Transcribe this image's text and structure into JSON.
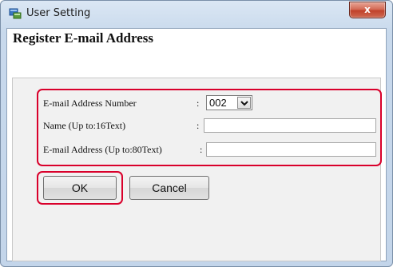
{
  "window": {
    "title": "User Setting",
    "close_label": "x"
  },
  "form": {
    "heading": "Register E-mail Address",
    "fields": [
      {
        "label": "E-mail Address Number",
        "colon": ":",
        "value": "002"
      },
      {
        "label": "Name (Up to:16Text)",
        "colon": ":",
        "value": ""
      },
      {
        "label": "E-mail Address (Up to:80Text)",
        "colon": ":",
        "value": ""
      }
    ]
  },
  "buttons": {
    "ok_label": "OK",
    "cancel_label": "Cancel"
  },
  "colors": {
    "highlight": "#d9002b",
    "title_bar": "#c8d9ec",
    "close_button": "#c0412a"
  },
  "icons": {
    "app": "user-setting-icon",
    "close": "close-icon",
    "dropdown": "chevron-down-icon"
  }
}
